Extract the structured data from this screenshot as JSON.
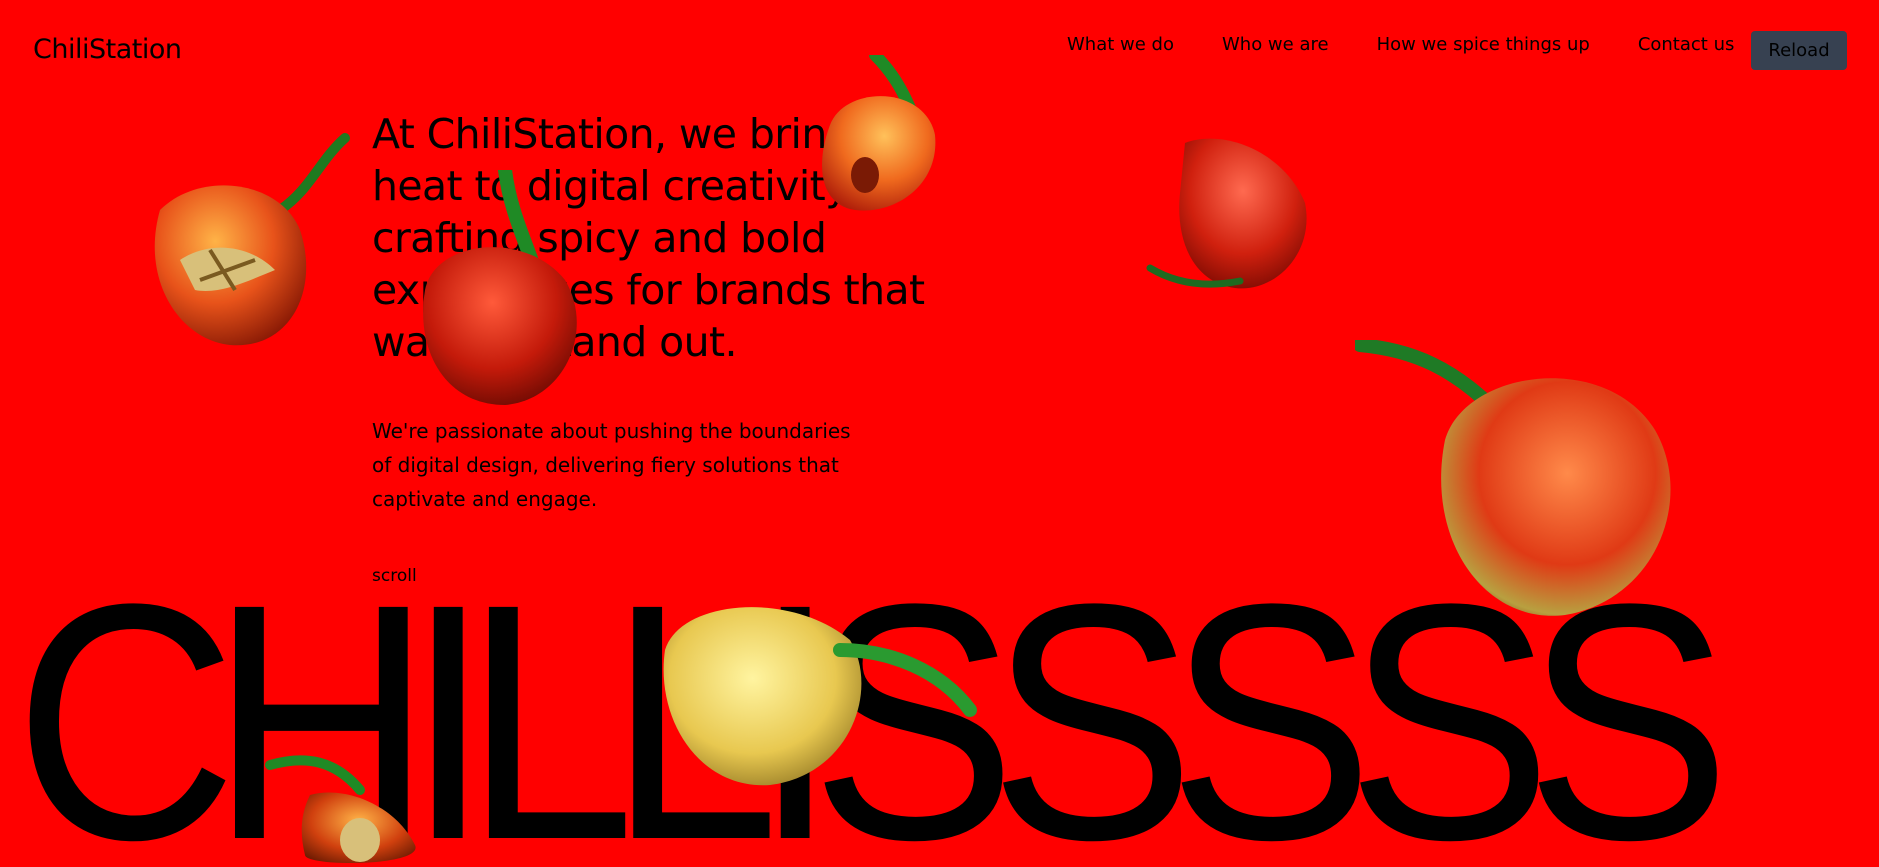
{
  "header": {
    "logo": "ChiliStation",
    "nav": [
      {
        "label": "What we do"
      },
      {
        "label": "Who we are"
      },
      {
        "label": "How we spice things up"
      },
      {
        "label": "Contact us"
      }
    ],
    "reload_label": "Reload"
  },
  "hero": {
    "headline": "At ChiliStation, we bring the heat to digital creativity, crafting spicy and bold experiences for brands that want to stand out.",
    "lede": "We're passionate about pushing the boundaries of digital design, delivering fiery solutions that captivate and engage.",
    "scroll_label": "scroll",
    "giant_word": "CHILLISSSSS"
  },
  "colors": {
    "background": "#ff0000",
    "button": "#374151",
    "text": "#000000"
  }
}
